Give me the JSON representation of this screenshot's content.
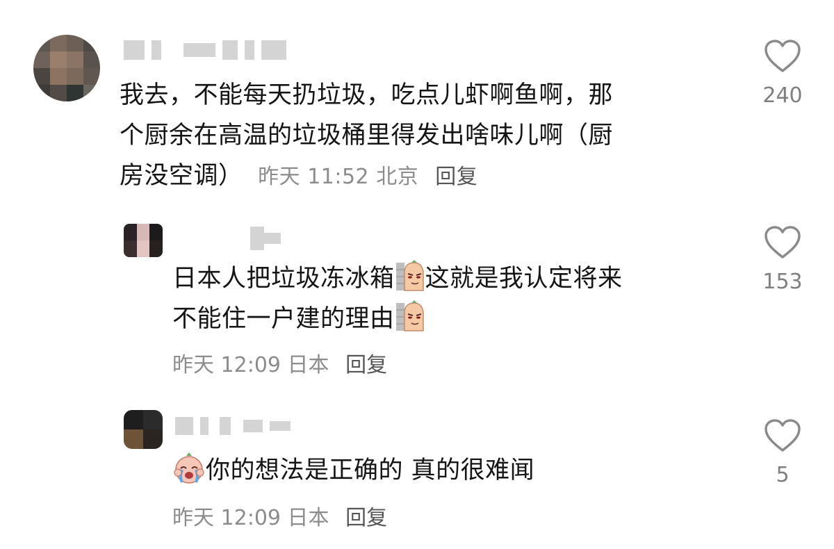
{
  "comments": [
    {
      "text_lines": [
        "我去，不能每天扔垃圾，吃点儿虾啊鱼啊，那",
        "个厨余在高温的垃圾桶里得发出啥味儿啊（厨",
        "房没空调）"
      ],
      "time": "昨天 11:52",
      "location": "北京",
      "reply_label": "回复",
      "likes": "240"
    },
    {
      "text_part1": "日本人把垃圾冻冰箱",
      "text_part2": "这就是我认定将来",
      "text_line2": "不能住一户建的理由",
      "time": "昨天 12:09",
      "location": "日本",
      "reply_label": "回复",
      "likes": "153"
    },
    {
      "text": "你的想法是正确的 真的很难闻",
      "time": "昨天 12:09",
      "location": "日本",
      "reply_label": "回复",
      "likes": "5"
    }
  ],
  "icons": {
    "like": "heart-outline-icon",
    "emoji_wall": "peeking-wall-emoji",
    "emoji_cry": "crying-face-emoji"
  },
  "colors": {
    "text": "#151515",
    "meta": "#8c8c8c",
    "reply": "#555555",
    "heart": "#8a8a8a"
  }
}
